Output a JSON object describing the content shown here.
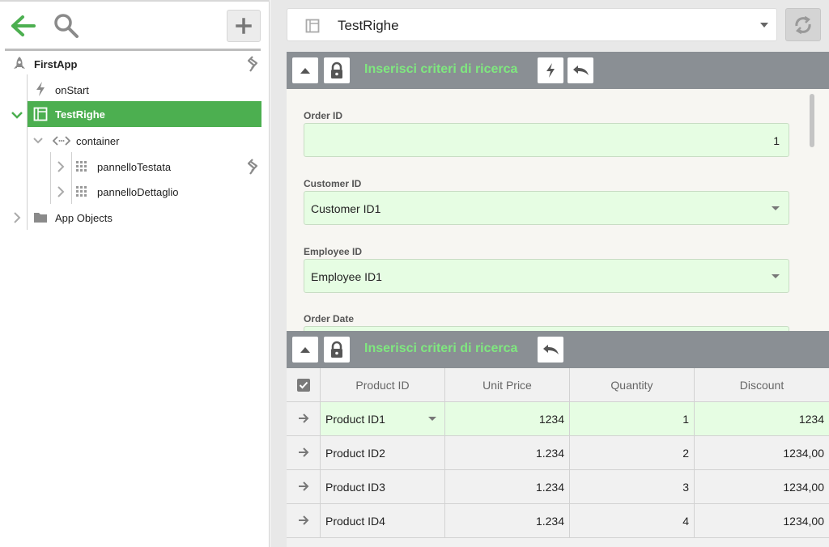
{
  "tree": {
    "app": "FirstApp",
    "on_start": "onStart",
    "selected": "TestRighe",
    "container": "container",
    "panel_header": "pannelloTestata",
    "panel_detail": "pannelloDettaglio",
    "app_objects": "App Objects"
  },
  "header": {
    "title": "TestRighe"
  },
  "search_panel": {
    "title": "Inserisci criteri di ricerca",
    "fields": [
      {
        "label": "Order ID",
        "value": "1"
      },
      {
        "label": "Customer ID",
        "value": "Customer ID1"
      },
      {
        "label": "Employee ID",
        "value": "Employee ID1"
      },
      {
        "label": "Order Date",
        "value": ""
      }
    ]
  },
  "grid_panel": {
    "title": "Inserisci criteri di ricerca",
    "columns": [
      "Product ID",
      "Unit Price",
      "Quantity",
      "Discount"
    ],
    "rows": [
      {
        "product": "Product ID1",
        "price": "1234",
        "qty": "1",
        "discount": "1234"
      },
      {
        "product": "Product ID2",
        "price": "1.234",
        "qty": "2",
        "discount": "1234,00"
      },
      {
        "product": "Product ID3",
        "price": "1.234",
        "qty": "3",
        "discount": "1234,00"
      },
      {
        "product": "Product ID4",
        "price": "1.234",
        "qty": "4",
        "discount": "1234,00"
      }
    ]
  },
  "colors": {
    "accent_green": "#4caf50",
    "header_title_green": "#7fe87f",
    "panel_header_gray": "#8a8f94",
    "input_green": "#e6fde3"
  }
}
